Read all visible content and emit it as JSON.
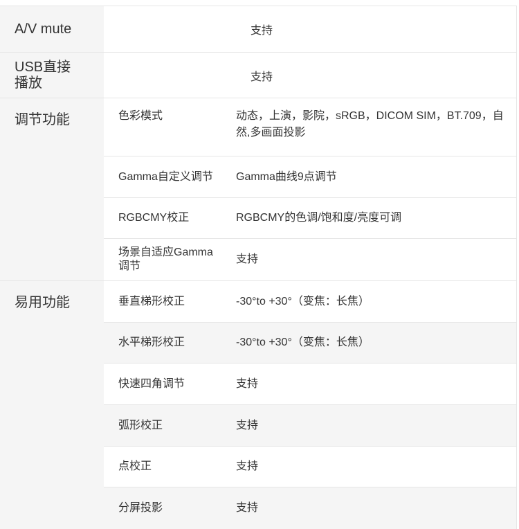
{
  "rows": [
    {
      "category": "A/V mute",
      "value": "支持"
    },
    {
      "category": "USB直接\n播放",
      "value": "支持"
    }
  ],
  "groups": [
    {
      "category": "调节功能",
      "items": [
        {
          "label": "色彩模式",
          "value": "动态，上演，影院，sRGB，DICOM SIM，BT.709，自然,多画面投影"
        },
        {
          "label": "Gamma自定义调节",
          "value": "Gamma曲线9点调节"
        },
        {
          "label": "RGBCMY校正",
          "value": "RGBCMY的色调/饱和度/亮度可调"
        },
        {
          "label": "场景自适应Gamma调节",
          "value": "支持"
        }
      ]
    },
    {
      "category": "易用功能",
      "items": [
        {
          "label": "垂直梯形校正",
          "value": "-30°to +30°（变焦：长焦）"
        },
        {
          "label": "水平梯形校正",
          "value": "-30°to +30°（变焦：长焦）"
        },
        {
          "label": "快速四角调节",
          "value": "支持"
        },
        {
          "label": "弧形校正",
          "value": "支持"
        },
        {
          "label": "点校正",
          "value": "支持"
        },
        {
          "label": "分屏投影",
          "value": "支持"
        }
      ]
    }
  ]
}
